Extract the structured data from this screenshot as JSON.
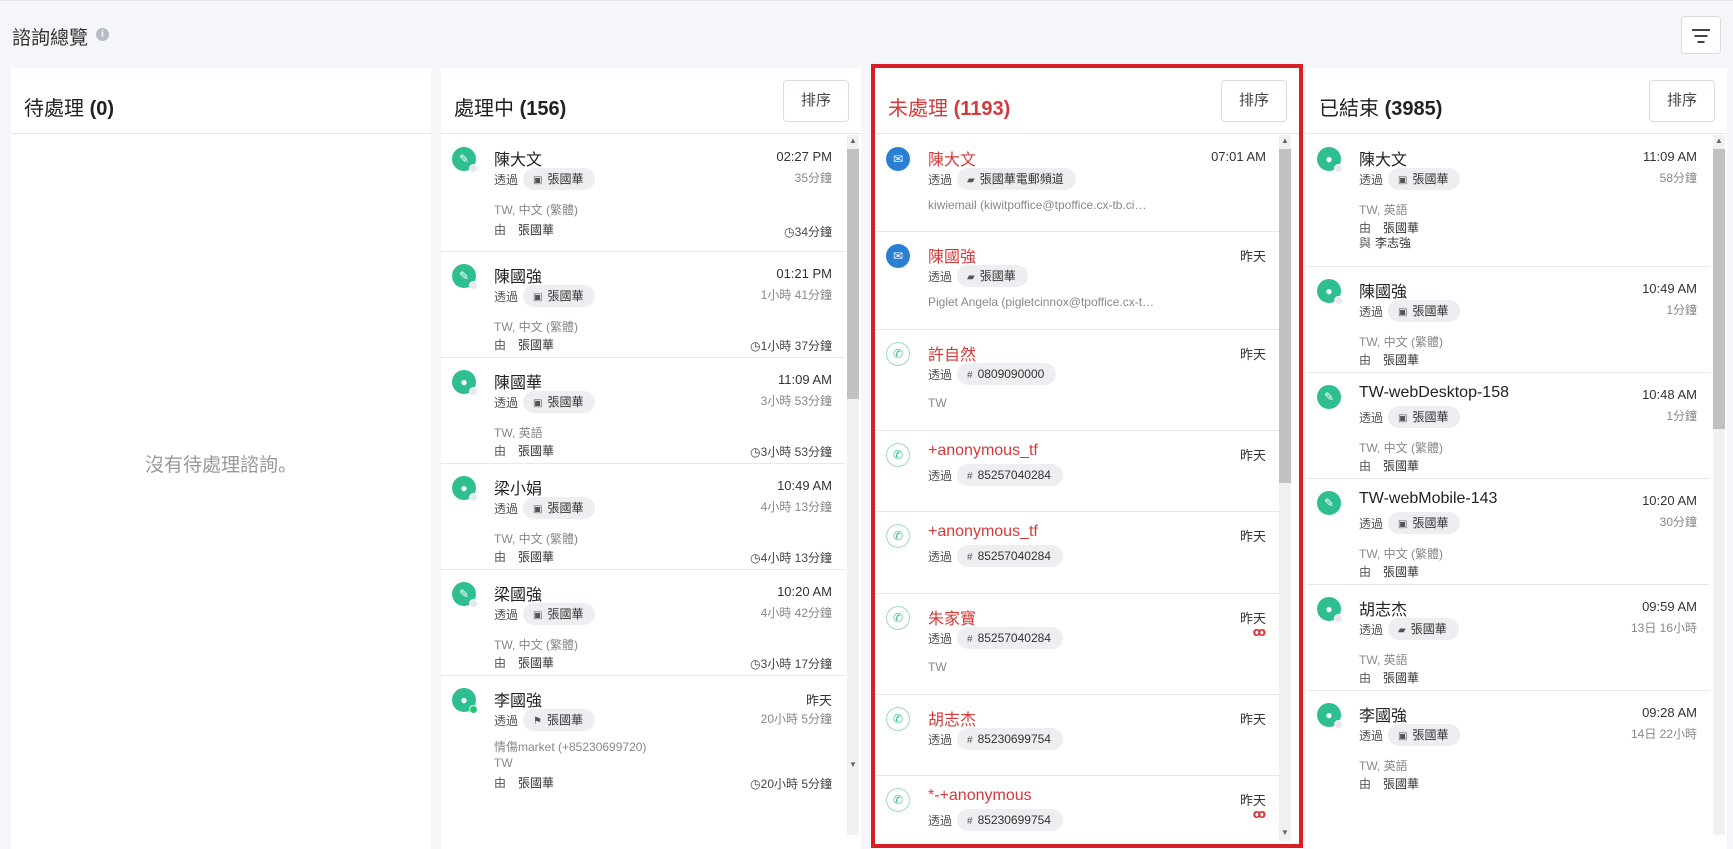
{
  "page": {
    "title": "諮詢總覽",
    "info_icon": "info-icon",
    "filter_icon": "filter-icon"
  },
  "columns": [
    {
      "title": "待處理",
      "count": "(0)",
      "empty_text": "沒有待處理諮詢。"
    },
    {
      "title": "處理中",
      "count": "(156)",
      "sort_label": "排序",
      "cards": [
        {
          "name": "陳大文",
          "time": "02:27 PM",
          "dur": "35分鐘",
          "via": "透過",
          "channel": "張國華",
          "meta": "TW, 中文 (繁體)",
          "by": "由",
          "agent": "張國華",
          "wait": "34分鐘",
          "icon": "ticket-icon"
        },
        {
          "name": "陳國強",
          "time": "01:21 PM",
          "dur": "1小時 41分鐘",
          "via": "透過",
          "channel": "張國華",
          "meta": "TW, 中文 (繁體)",
          "by": "由",
          "agent": "張國華",
          "wait": "1小時 37分鐘",
          "icon": "ticket-icon"
        },
        {
          "name": "陳國華",
          "time": "11:09 AM",
          "dur": "3小時 53分鐘",
          "via": "透過",
          "channel": "張國華",
          "meta": "TW, 英語",
          "by": "由",
          "agent": "張國華",
          "wait": "3小時 53分鐘",
          "icon": "person-icon"
        },
        {
          "name": "梁小娟",
          "time": "10:49 AM",
          "dur": "4小時 13分鐘",
          "via": "透過",
          "channel": "張國華",
          "meta": "TW, 中文 (繁體)",
          "by": "由",
          "agent": "張國華",
          "wait": "4小時 13分鐘",
          "icon": "person-icon"
        },
        {
          "name": "梁國強",
          "time": "10:20 AM",
          "dur": "4小時 42分鐘",
          "via": "透過",
          "channel": "張國華",
          "meta": "TW, 中文 (繁體)",
          "by": "由",
          "agent": "張國華",
          "wait": "3小時 17分鐘",
          "icon": "ticket-icon"
        },
        {
          "name": "李國強",
          "time": "昨天",
          "dur": "20小時 5分鐘",
          "via": "透過",
          "channel": "張國華",
          "meta": "情傷market (+85230699720)",
          "meta2": "TW",
          "by": "由",
          "agent": "張國華",
          "wait": "20小時 5分鐘",
          "icon": "person-icon"
        }
      ]
    },
    {
      "title": "未處理",
      "count": "(1193)",
      "sort_label": "排序",
      "cards": [
        {
          "name": "陳大文",
          "time": "07:01 AM",
          "via": "透過",
          "channel": "張國華電郵頻道",
          "meta": "kiwiemail (kiwitpoffice@tpoffice.cx-tb.ci…",
          "icon": "email-icon"
        },
        {
          "name": "陳國強",
          "time": "昨天",
          "via": "透過",
          "channel": "張國華",
          "meta": "Piglet Angela (pigletcinnox@tpoffice.cx-t…",
          "icon": "email-icon"
        },
        {
          "name": "許自然",
          "time": "昨天",
          "via": "透過",
          "channel": "0809090000",
          "meta": "TW",
          "icon": "phone-icon"
        },
        {
          "name": "+anonymous_tf",
          "time": "昨天",
          "via": "透過",
          "channel": "85257040284",
          "icon": "phone-icon"
        },
        {
          "name": "+anonymous_tf",
          "time": "昨天",
          "via": "透過",
          "channel": "85257040284",
          "icon": "phone-icon"
        },
        {
          "name": "朱家寶",
          "time": "昨天",
          "via": "透過",
          "channel": "85257040284",
          "meta": "TW",
          "icon": "phone-icon",
          "voicemail": "ꝏ"
        },
        {
          "name": "胡志杰",
          "time": "昨天",
          "via": "透過",
          "channel": "85230699754",
          "icon": "phone-icon"
        },
        {
          "name": "*-+anonymous",
          "time": "昨天",
          "via": "透過",
          "channel": "85230699754",
          "icon": "phone-icon",
          "voicemail": "ꝏ"
        }
      ]
    },
    {
      "title": "已結束",
      "count": "(3985)",
      "sort_label": "排序",
      "cards": [
        {
          "name": "陳大文",
          "time": "11:09 AM",
          "dur": "58分鐘",
          "via": "透過",
          "channel": "張國華",
          "meta": "TW, 英語",
          "by": "由",
          "agent": "張國華",
          "with": "與",
          "with_agent": "李志強",
          "icon": "person-icon"
        },
        {
          "name": "陳國強",
          "time": "10:49 AM",
          "dur": "1分鐘",
          "via": "透過",
          "channel": "張國華",
          "meta": "TW, 中文 (繁體)",
          "by": "由",
          "agent": "張國華",
          "icon": "person-icon"
        },
        {
          "name": "TW-webDesktop-158",
          "time": "10:48 AM",
          "dur": "1分鐘",
          "via": "透過",
          "channel": "張國華",
          "meta": "TW, 中文 (繁體)",
          "by": "由",
          "agent": "張國華",
          "icon": "ticket-icon"
        },
        {
          "name": "TW-webMobile-143",
          "time": "10:20 AM",
          "dur": "30分鐘",
          "via": "透過",
          "channel": "張國華",
          "meta": "TW, 中文 (繁體)",
          "by": "由",
          "agent": "張國華",
          "icon": "ticket-icon"
        },
        {
          "name": "胡志杰",
          "time": "09:59 AM",
          "dur": "13日 16小時",
          "via": "透過",
          "channel": "張國華",
          "meta": "TW, 英語",
          "by": "由",
          "agent": "張國華",
          "icon": "person-icon"
        },
        {
          "name": "李國強",
          "time": "09:28 AM",
          "dur": "14日 22小時",
          "via": "透過",
          "channel": "張國華",
          "meta": "TW, 英語",
          "by": "由",
          "agent": "張國華",
          "icon": "person-icon"
        }
      ]
    }
  ]
}
